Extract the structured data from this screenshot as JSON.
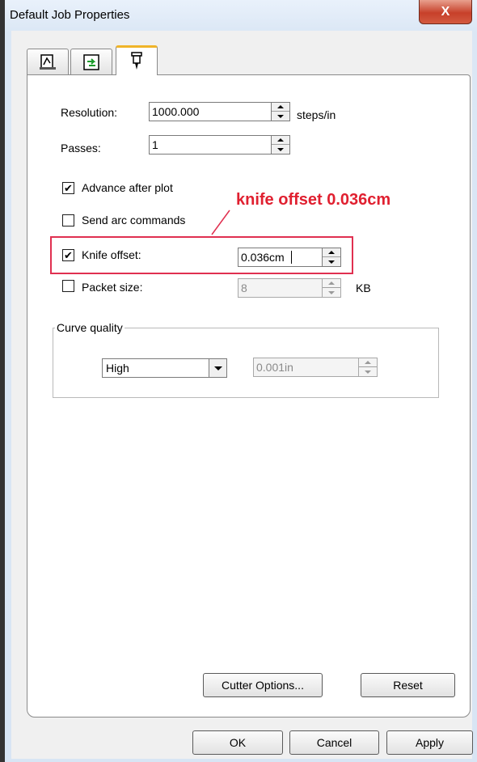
{
  "window": {
    "title": "Default Job Properties",
    "close_label": "X"
  },
  "tabs": [
    {
      "icon": "plot-page-icon",
      "active": false
    },
    {
      "icon": "refresh-arrows-icon",
      "active": false
    },
    {
      "icon": "cutter-knife-icon",
      "active": true
    }
  ],
  "fields": {
    "resolution": {
      "label": "Resolution:",
      "value": "1000.000",
      "unit": "steps/in"
    },
    "passes": {
      "label": "Passes:",
      "value": "1"
    },
    "advance_after_plot": {
      "label": "Advance after plot",
      "checked": true
    },
    "send_arc_commands": {
      "label": "Send arc commands",
      "checked": false
    },
    "knife_offset": {
      "label": "Knife offset:",
      "checked": true,
      "value": "0.036cm"
    },
    "packet_size": {
      "label": "Packet size:",
      "checked": false,
      "value": "8",
      "unit": "KB"
    }
  },
  "annotation": "knife offset 0.036cm",
  "curve_quality": {
    "group_label": "Curve quality",
    "selected": "High",
    "tolerance_value": "0.001in"
  },
  "buttons": {
    "cutter_options": "Cutter Options...",
    "reset": "Reset",
    "ok": "OK",
    "cancel": "Cancel",
    "apply": "Apply"
  },
  "colors": {
    "annotation": "#e02030",
    "active_tab_accent": "#f0b429",
    "close_button": "#c7402a"
  }
}
